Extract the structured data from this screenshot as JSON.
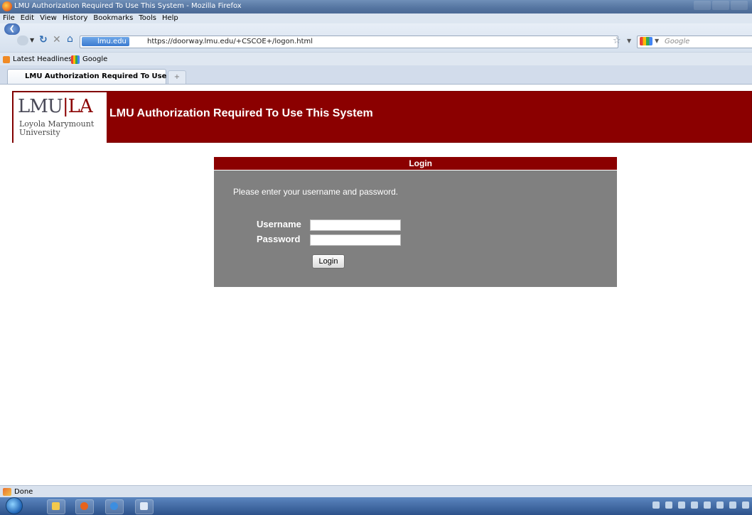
{
  "window": {
    "title": "LMU Authorization Required To Use This System - Mozilla Firefox"
  },
  "menu": {
    "items": [
      "File",
      "Edit",
      "View",
      "History",
      "Bookmarks",
      "Tools",
      "Help"
    ]
  },
  "navigation": {
    "site_identity": "lmu.edu",
    "url": "https://doorway.lmu.edu/+CSCOE+/logon.html",
    "search_placeholder": "Google"
  },
  "bookmarks": {
    "items": [
      "Latest Headlines",
      "Google"
    ]
  },
  "tabs": {
    "active_label": "LMU Authorization Required To Use ...",
    "new_tab_symbol": "+"
  },
  "header": {
    "logo_left": "LMU",
    "logo_right": "LA",
    "logo_subtitle_line1": "Loyola Marymount",
    "logo_subtitle_line2": "University",
    "title": "LMU Authorization Required To Use This System"
  },
  "login": {
    "heading": "Login",
    "prompt": "Please enter your username and password.",
    "username_label": "Username",
    "password_label": "Password",
    "username_value": "",
    "password_value": "",
    "button_label": "Login"
  },
  "status": {
    "text": "Done"
  },
  "colors": {
    "brand": "#8b0000",
    "panel": "#808080"
  }
}
